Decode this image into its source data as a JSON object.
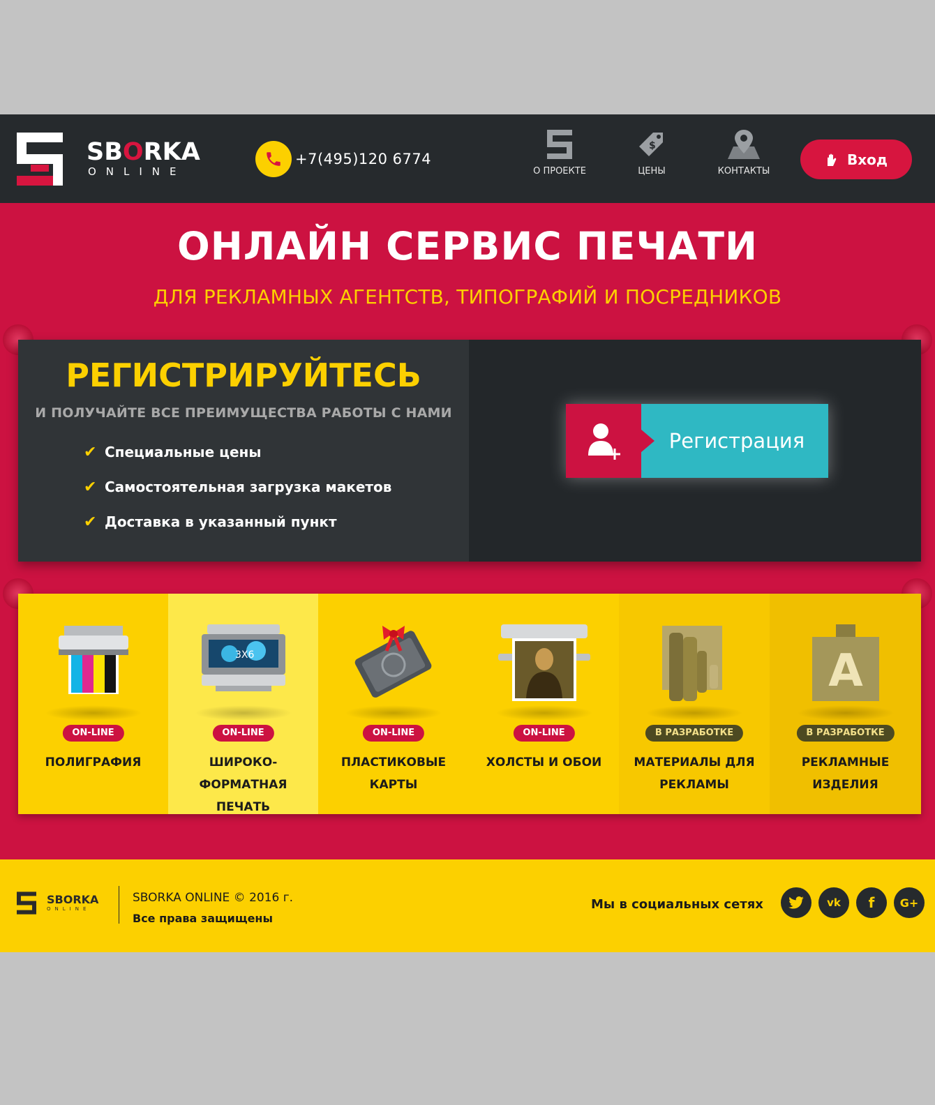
{
  "colors": {
    "header_bg": "#262a2d",
    "accent_red": "#cc1241",
    "accent_yellow": "#fcd000",
    "register_teal": "#2fb8c3"
  },
  "header": {
    "brand_main": "SBORKA",
    "brand_sub": "ONLINE",
    "phone": "+7(495)120 6774",
    "nav": [
      {
        "label": "О ПРОЕКТЕ",
        "icon": "project-logo-icon"
      },
      {
        "label": "ЦЕНЫ",
        "icon": "price-tag-icon"
      },
      {
        "label": "КОНТАКТЫ",
        "icon": "map-pin-icon"
      }
    ],
    "login_label": "Вход"
  },
  "hero": {
    "title": "ОНЛАЙН СЕРВИС ПЕЧАТИ",
    "subtitle": "ДЛЯ РЕКЛАМНЫХ АГЕНТСТВ, ТИПОГРАФИЙ И ПОСРЕДНИКОВ"
  },
  "register": {
    "title": "РЕГИСТРИРУЙТЕСЬ",
    "subtitle": "И ПОЛУЧАЙТЕ ВСЕ ПРЕИМУЩЕСТВА РАБОТЫ С НАМИ",
    "benefits": [
      "Специальные цены",
      "Самостоятельная загрузка макетов",
      "Доставка в указанный пункт"
    ],
    "button_label": "Регистрация"
  },
  "categories": [
    {
      "badge": "ON-LINE",
      "name": "ПОЛИГРАФИЯ",
      "icon": "printer-cmyk-icon"
    },
    {
      "badge": "ON-LINE",
      "name": "ШИРОКО-ФОРМАТНАЯ ПЕЧАТЬ",
      "icon": "wide-format-printer-icon",
      "art_text": "3X6"
    },
    {
      "badge": "ON-LINE",
      "name": "ПЛАСТИКОВЫЕ КАРТЫ",
      "icon": "plastic-cards-icon"
    },
    {
      "badge": "ON-LINE",
      "name": "ХОЛСТЫ И ОБОИ",
      "icon": "canvas-print-icon"
    },
    {
      "badge": "В РАЗРАБОТКЕ",
      "name": "МАТЕРИАЛЫ ДЛЯ РЕКЛАМЫ",
      "icon": "materials-icon"
    },
    {
      "badge": "В РАЗРАБОТКЕ",
      "name": "РЕКЛАМНЫЕ ИЗДЕЛИЯ",
      "icon": "promo-products-icon",
      "art_text": "A"
    }
  ],
  "footer": {
    "brand_main": "SBORKA",
    "brand_sub": "ONLINE",
    "copyright": "SBORKA ONLINE © 2016 г.",
    "rights": "Все права защищены",
    "social_label": "Мы в социальных сетях",
    "social": [
      "twitter-icon",
      "vk-icon",
      "facebook-icon",
      "google-plus-icon"
    ],
    "social_glyphs": [
      "t",
      "vk",
      "f",
      "G+"
    ]
  }
}
